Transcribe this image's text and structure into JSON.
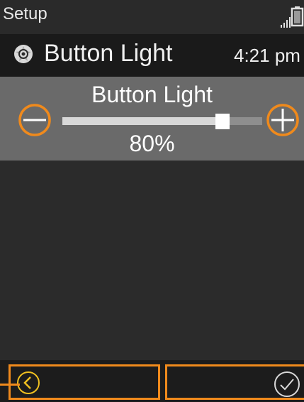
{
  "status_bar": {
    "title": "Setup",
    "signal_icon": "signal-bars-icon",
    "battery_icon": "battery-icon"
  },
  "header": {
    "icon": "settings-gear-icon",
    "title": "Button Light",
    "time": "4:21 pm"
  },
  "slider": {
    "label": "Button Light",
    "value_text": "80%",
    "value_fraction": 0.8,
    "decrease_icon": "minus-icon",
    "increase_icon": "plus-icon"
  },
  "softkeys": {
    "left_icon": "back-chevron-icon",
    "right_icon": "checkmark-icon"
  },
  "colors": {
    "accent": "#f08a1c",
    "panel": "#6a6a6a",
    "background": "#2b2b2b",
    "header": "#1a1a1a"
  }
}
